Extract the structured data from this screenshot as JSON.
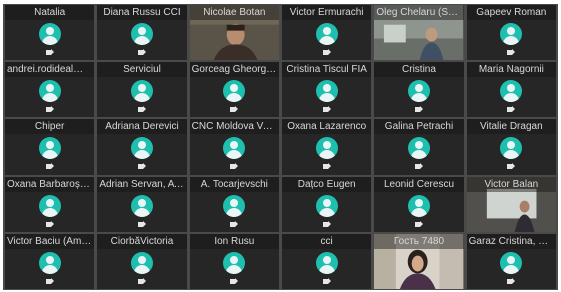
{
  "participants": [
    {
      "name": "Natalia",
      "video": false
    },
    {
      "name": "Diana Russu CCI",
      "video": false
    },
    {
      "name": "Nicolae Botan",
      "video": true,
      "scene": "office"
    },
    {
      "name": "Victor Ermurachi",
      "video": false
    },
    {
      "name": "Oleg Chelaru (SEI...",
      "video": true,
      "scene": "desk"
    },
    {
      "name": "Gapeev Roman",
      "video": false
    },
    {
      "name": "andrei.rodideal@g...",
      "video": false
    },
    {
      "name": "Serviciul",
      "video": false
    },
    {
      "name": "Gorceag Gheorgh...",
      "video": false
    },
    {
      "name": "Cristina Tiscul FIA",
      "video": false
    },
    {
      "name": "Cristina",
      "video": false
    },
    {
      "name": "Maria Nagornii",
      "video": false
    },
    {
      "name": "Chiper",
      "video": false
    },
    {
      "name": "Adriana Derevici",
      "video": false
    },
    {
      "name": "CNC Moldova Val...",
      "video": false
    },
    {
      "name": "Oxana Lazarenco",
      "video": false
    },
    {
      "name": "Galina Petrachi",
      "video": false
    },
    {
      "name": "Vitalie Dragan",
      "video": false
    },
    {
      "name": "Oxana Barbaroș, A...",
      "video": false
    },
    {
      "name": "Adrian Servan, ATI...",
      "video": false
    },
    {
      "name": "A. Tocarjevschi",
      "video": false
    },
    {
      "name": "Dațco Eugen",
      "video": false
    },
    {
      "name": "Leonid Cerescu",
      "video": false
    },
    {
      "name": "Victor Balan",
      "video": true,
      "scene": "window"
    },
    {
      "name": "Victor Baciu (AmC...",
      "video": false
    },
    {
      "name": "CiorbăVictoria",
      "video": false
    },
    {
      "name": "Ion Rusu",
      "video": false
    },
    {
      "name": "cci",
      "video": false
    },
    {
      "name": "Гость 7480",
      "video": true,
      "scene": "woman"
    },
    {
      "name": "Garaz Cristina, EB...",
      "video": false
    }
  ],
  "colors": {
    "avatar": "#1fbfb0",
    "tile": "#262626",
    "background": "#4a4a4a"
  },
  "icons": {
    "avatar": "default-user-avatar-icon",
    "camera": "camera-off-icon"
  }
}
